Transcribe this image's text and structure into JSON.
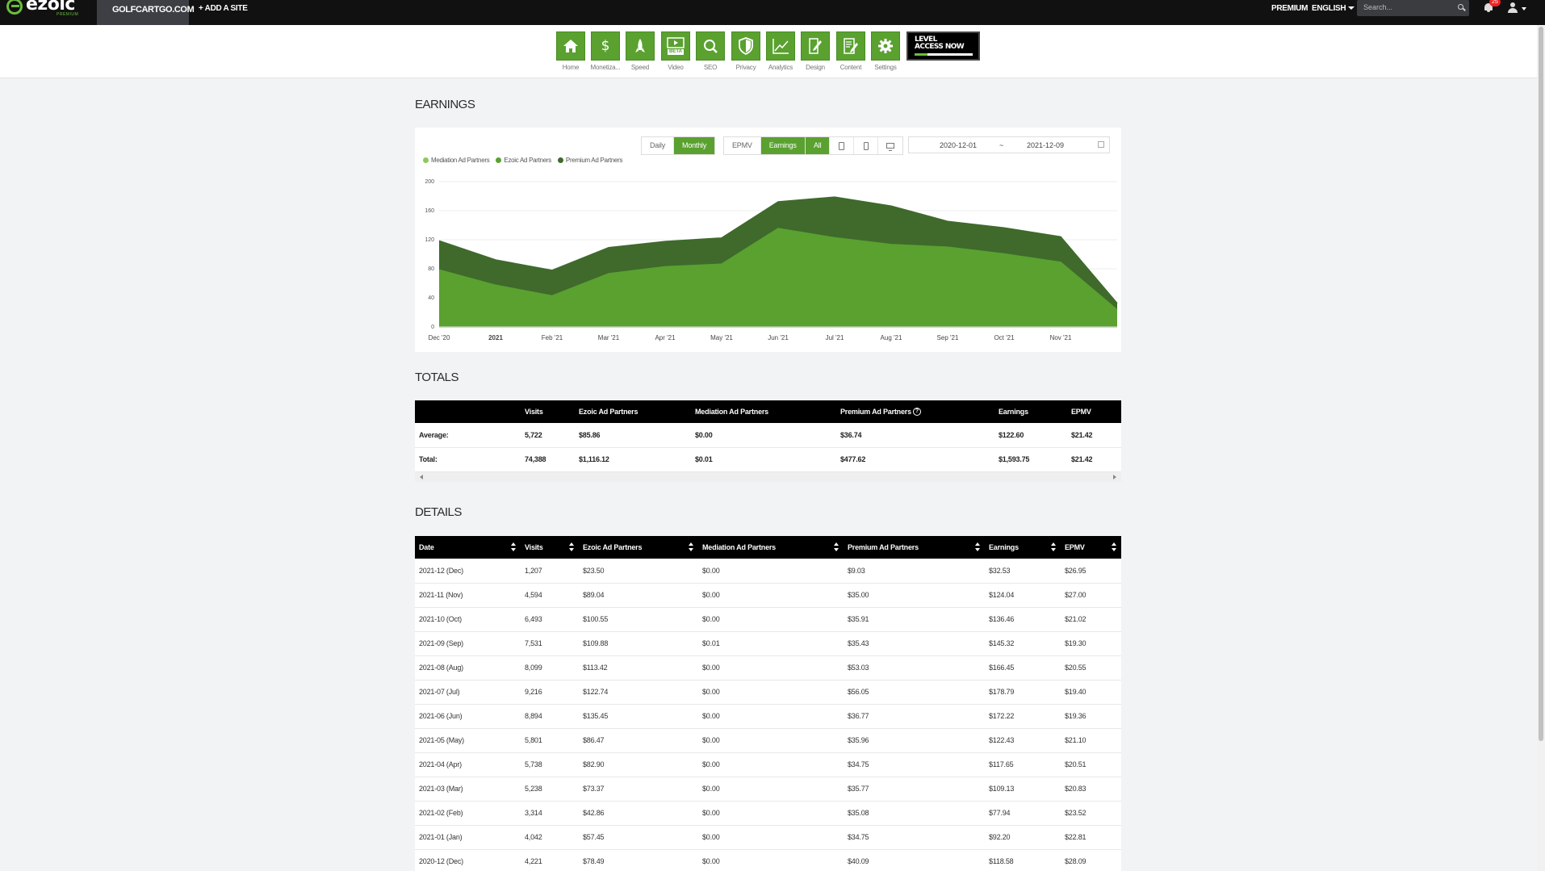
{
  "topbar": {
    "logo": "ezoic",
    "logo_sub": "PREMIUM",
    "site": "GOLFCARTGO.COM",
    "add_site": "+ ADD A SITE",
    "premium": "PREMIUM",
    "language": "ENGLISH",
    "search_placeholder": "Search...",
    "notification_count": "25"
  },
  "nav": {
    "items": [
      {
        "label": "Home",
        "icon": "home-icon"
      },
      {
        "label": "Monetiza...",
        "icon": "dollar-icon"
      },
      {
        "label": "Speed",
        "icon": "rocket-icon"
      },
      {
        "label": "Video",
        "icon": "video-icon",
        "badge": "BETA"
      },
      {
        "label": "SEO",
        "icon": "magnifier-icon"
      },
      {
        "label": "Privacy",
        "icon": "shield-icon"
      },
      {
        "label": "Analytics",
        "icon": "line-chart-icon"
      },
      {
        "label": "Design",
        "icon": "design-icon"
      },
      {
        "label": "Content",
        "icon": "content-icon"
      },
      {
        "label": "Settings",
        "icon": "gear-icon"
      }
    ],
    "level_banner_line1": "LEVEL",
    "level_banner_line2": "ACCESS NOW"
  },
  "earnings": {
    "title": "EARNINGS",
    "period_buttons": [
      "Daily",
      "Monthly"
    ],
    "period_active": "Monthly",
    "metric_buttons": [
      "EPMV",
      "Earnings"
    ],
    "metric_active": "Earnings",
    "device_all": "All",
    "date_start": "2020-12-01",
    "date_sep": "~",
    "date_end": "2021-12-09"
  },
  "chart_data": {
    "type": "area",
    "stacked": true,
    "categories": [
      "Dec '20",
      "2021",
      "Feb '21",
      "Mar '21",
      "Apr '21",
      "May '21",
      "Jun '21",
      "Jul '21",
      "Aug '21",
      "Sep '21",
      "Oct '21",
      "Nov '21",
      "Dec '21"
    ],
    "x_tick_labels": [
      "Dec '20",
      "2021",
      "Feb '21",
      "Mar '21",
      "Apr '21",
      "May '21",
      "Jun '21",
      "Jul '21",
      "Aug '21",
      "Sep '21",
      "Oct '21",
      "Nov '21"
    ],
    "series": [
      {
        "name": "Mediation Ad Partners",
        "color": "#8cc95f",
        "values": [
          0,
          0,
          0,
          0,
          0,
          0,
          0,
          0,
          0,
          0.01,
          0,
          0,
          0
        ]
      },
      {
        "name": "Ezoic Ad Partners",
        "color": "#5aa130",
        "values": [
          78.49,
          57.45,
          42.86,
          73.37,
          82.9,
          86.47,
          135.45,
          122.74,
          113.42,
          109.88,
          100.55,
          89.04,
          23.5
        ]
      },
      {
        "name": "Premium Ad Partners",
        "color": "#3f6a2c",
        "values": [
          40.09,
          34.75,
          35.08,
          35.77,
          34.75,
          35.96,
          36.77,
          56.05,
          53.03,
          35.43,
          35.91,
          35.0,
          9.03
        ]
      }
    ],
    "ylim": [
      0,
      200
    ],
    "yticks": [
      0,
      40,
      80,
      120,
      160,
      200
    ],
    "grid": true,
    "legend": "top-left"
  },
  "totals": {
    "title": "TOTALS",
    "columns": [
      "",
      "Visits",
      "Ezoic Ad Partners",
      "Mediation Ad Partners",
      "Premium Ad Partners",
      "Earnings",
      "EPMV"
    ],
    "rows": [
      [
        "Average:",
        "5,722",
        "$85.86",
        "$0.00",
        "$36.74",
        "$122.60",
        "$21.42"
      ],
      [
        "Total:",
        "74,388",
        "$1,116.12",
        "$0.01",
        "$477.62",
        "$1,593.75",
        "$21.42"
      ]
    ]
  },
  "details": {
    "title": "DETAILS",
    "columns": [
      "Date",
      "Visits",
      "Ezoic Ad Partners",
      "Mediation Ad Partners",
      "Premium Ad Partners",
      "Earnings",
      "EPMV"
    ],
    "rows": [
      [
        "2021-12 (Dec)",
        "1,207",
        "$23.50",
        "$0.00",
        "$9.03",
        "$32.53",
        "$26.95"
      ],
      [
        "2021-11 (Nov)",
        "4,594",
        "$89.04",
        "$0.00",
        "$35.00",
        "$124.04",
        "$27.00"
      ],
      [
        "2021-10 (Oct)",
        "6,493",
        "$100.55",
        "$0.00",
        "$35.91",
        "$136.46",
        "$21.02"
      ],
      [
        "2021-09 (Sep)",
        "7,531",
        "$109.88",
        "$0.01",
        "$35.43",
        "$145.32",
        "$19.30"
      ],
      [
        "2021-08 (Aug)",
        "8,099",
        "$113.42",
        "$0.00",
        "$53.03",
        "$166.45",
        "$20.55"
      ],
      [
        "2021-07 (Jul)",
        "9,216",
        "$122.74",
        "$0.00",
        "$56.05",
        "$178.79",
        "$19.40"
      ],
      [
        "2021-06 (Jun)",
        "8,894",
        "$135.45",
        "$0.00",
        "$36.77",
        "$172.22",
        "$19.36"
      ],
      [
        "2021-05 (May)",
        "5,801",
        "$86.47",
        "$0.00",
        "$35.96",
        "$122.43",
        "$21.10"
      ],
      [
        "2021-04 (Apr)",
        "5,738",
        "$82.90",
        "$0.00",
        "$34.75",
        "$117.65",
        "$20.51"
      ],
      [
        "2021-03 (Mar)",
        "5,238",
        "$73.37",
        "$0.00",
        "$35.77",
        "$109.13",
        "$20.83"
      ],
      [
        "2021-02 (Feb)",
        "3,314",
        "$42.86",
        "$0.00",
        "$35.08",
        "$77.94",
        "$23.52"
      ],
      [
        "2021-01 (Jan)",
        "4,042",
        "$57.45",
        "$0.00",
        "$34.75",
        "$92.20",
        "$22.81"
      ],
      [
        "2020-12 (Dec)",
        "4,221",
        "$78.49",
        "$0.00",
        "$40.09",
        "$118.58",
        "$28.09"
      ]
    ]
  }
}
